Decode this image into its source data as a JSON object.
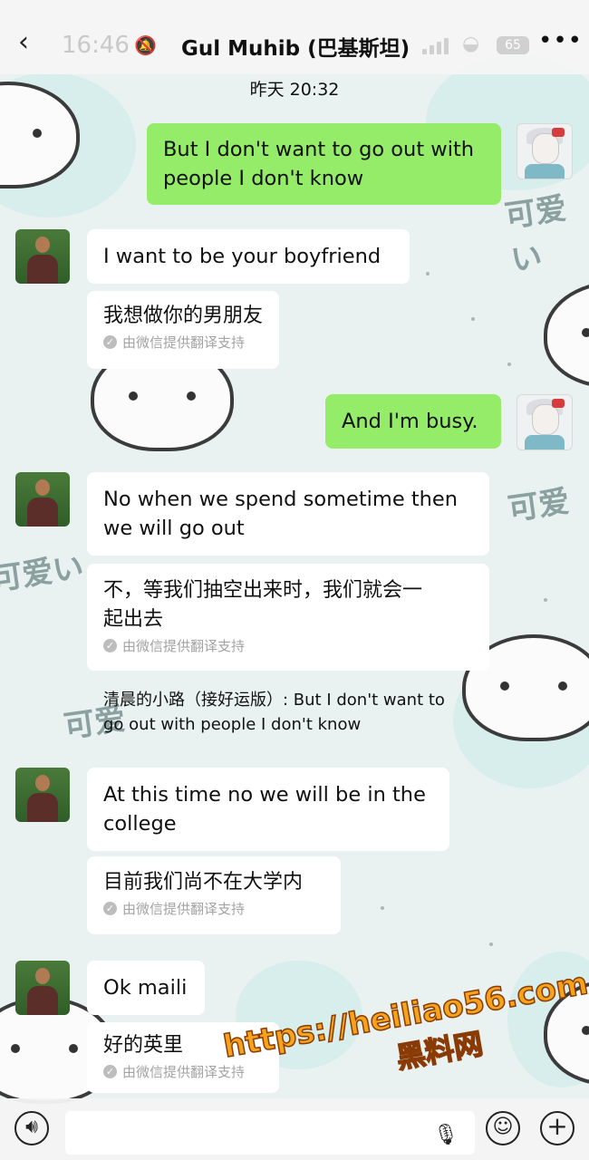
{
  "header": {
    "back": "‹",
    "status_time": "16:46",
    "title": "Gul Muhib (巴基斯坦)",
    "battery": "65",
    "more": "•••"
  },
  "timestamp": "昨天 20:32",
  "messages": [
    {
      "text": "But I don't want to go out with\npeople I don't know"
    },
    {
      "text": "I want to be your boyfriend",
      "translation": "我想做你的男朋友",
      "credit": "由微信提供翻译支持"
    },
    {
      "text": "And I'm busy."
    },
    {
      "text": "No when we spend sometime then\nwe will go out",
      "translation": "不，等我们抽空出来时，我们就会一\n起出去",
      "credit": "由微信提供翻译支持",
      "quote": "清晨的小路（接好运版）: But I don't want to\ngo out with people I don't know"
    },
    {
      "text": "At this time no we will be in the\ncollege",
      "translation": "目前我们尚不在大学内",
      "credit": "由微信提供翻译支持"
    },
    {
      "text": "Ok maili",
      "translation": "好的英里",
      "credit": "由微信提供翻译支持"
    }
  ],
  "wallpaper_text": [
    "可爱い",
    "可爱",
    "可爱い",
    "可爱"
  ],
  "watermark": {
    "line1": "https://heiliao56.com",
    "line2": "黑料网"
  },
  "input": {
    "placeholder": ""
  },
  "icons": [
    "back-icon",
    "mute-bell-icon",
    "signal-icon",
    "wifi-icon",
    "battery-icon",
    "more-icon",
    "voice-icon",
    "mic-icon",
    "emoji-icon",
    "plus-icon"
  ]
}
